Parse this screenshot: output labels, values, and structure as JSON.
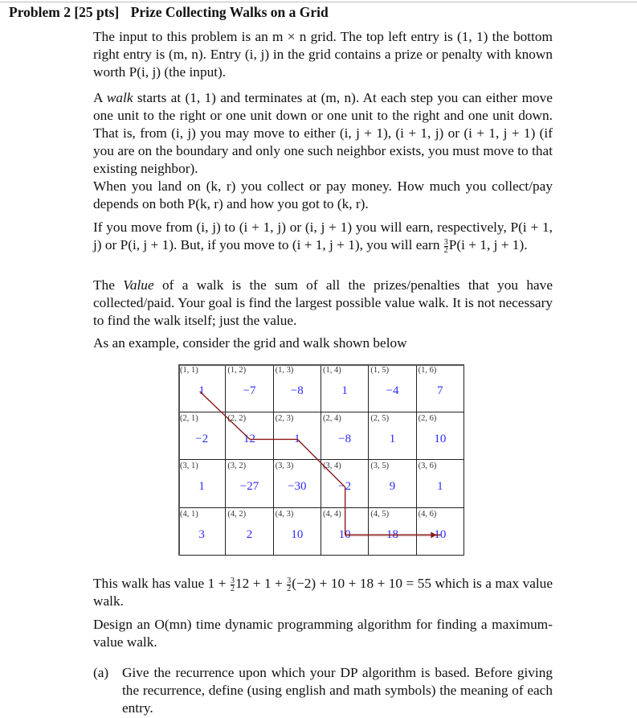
{
  "problem": {
    "number_label": "Problem 2",
    "points_label": "[25 pts]",
    "title": "Prize Collecting Walks on a Grid"
  },
  "paragraphs": {
    "p1": "The input to this problem is an m × n grid. The top left entry is (1, 1) the bottom right entry is (m, n). Entry (i, j) in the grid contains a prize or penalty with known worth P(i, j) (the input).",
    "p2_a": "A ",
    "p2_walk": "walk",
    "p2_b": " starts at (1, 1) and terminates at (m, n). At each step you can either move one unit to the right or one unit down or one unit to the right and one unit down. That is, from (i, j) you may move to either (i, j + 1), (i + 1, j) or (i + 1, j + 1) (if you are on the boundary and only one such neighbor exists, you must move to that existing neighbor).",
    "p3": "When you land on (k, r) you collect or pay money. How much you collect/pay depends on both P(k, r) and how you got to (k, r).",
    "p4_a": "If you move from (i, j) to (i + 1, j) or (i, j + 1) you will earn, respectively, P(i + 1, j) or P(i, j + 1). But, if you move to (i + 1, j + 1), you will earn ",
    "p4_frac_num": "3",
    "p4_frac_den": "2",
    "p4_b": "P(i + 1, j + 1).",
    "p5_a": "The ",
    "p5_value": "Value",
    "p5_b": " of a walk is the sum of all the prizes/penalties that you have collected/paid. Your goal is find the largest possible value walk. It is not necessary to find the walk itself; just the value.",
    "p6": "As an example, consider the grid and walk shown below",
    "p7_a": "This walk has value 1 + ",
    "p7_b": "12 + 1 + ",
    "p7_c": "(−2) + 10 + 18 + 10 = 55 which is a max value walk.",
    "p7_frac_num": "3",
    "p7_frac_den": "2",
    "p8": "Design an O(mn) time dynamic programming algorithm for finding a maximum-value walk."
  },
  "parts": [
    {
      "label": "(a)",
      "text": "Give the recurrence upon which your DP algorithm is based. Before giving the recurrence, define (using english and math symbols) the meaning of each entry."
    }
  ],
  "grid": {
    "rows": 4,
    "cols": 6,
    "cells": [
      [
        {
          "coord": "(1, 1)",
          "value": "1"
        },
        {
          "coord": "(1, 2)",
          "value": "−7"
        },
        {
          "coord": "(1, 3)",
          "value": "−8"
        },
        {
          "coord": "(1, 4)",
          "value": "1"
        },
        {
          "coord": "(1, 5)",
          "value": "−4"
        },
        {
          "coord": "(1, 6)",
          "value": "7"
        }
      ],
      [
        {
          "coord": "(2, 1)",
          "value": "−2"
        },
        {
          "coord": "(2, 2)",
          "value": "12"
        },
        {
          "coord": "(2, 3)",
          "value": "1"
        },
        {
          "coord": "(2, 4)",
          "value": "−8"
        },
        {
          "coord": "(2, 5)",
          "value": "1"
        },
        {
          "coord": "(2, 6)",
          "value": "10"
        }
      ],
      [
        {
          "coord": "(3, 1)",
          "value": "1"
        },
        {
          "coord": "(3, 2)",
          "value": "−27"
        },
        {
          "coord": "(3, 3)",
          "value": "−30"
        },
        {
          "coord": "(3, 4)",
          "value": "−2"
        },
        {
          "coord": "(3, 5)",
          "value": "9"
        },
        {
          "coord": "(3, 6)",
          "value": "1"
        }
      ],
      [
        {
          "coord": "(4, 1)",
          "value": "3"
        },
        {
          "coord": "(4, 2)",
          "value": "2"
        },
        {
          "coord": "(4, 3)",
          "value": "10"
        },
        {
          "coord": "(4, 4)",
          "value": "10"
        },
        {
          "coord": "(4, 5)",
          "value": "18"
        },
        {
          "coord": "(4, 6)",
          "value": "10"
        }
      ]
    ],
    "walk_path": [
      [
        1,
        1
      ],
      [
        2,
        2
      ],
      [
        2,
        3
      ],
      [
        3,
        4
      ],
      [
        4,
        4
      ],
      [
        4,
        5
      ],
      [
        4,
        6
      ]
    ],
    "value_color": "#2b2bff",
    "walk_color": "#8b1a1a"
  }
}
